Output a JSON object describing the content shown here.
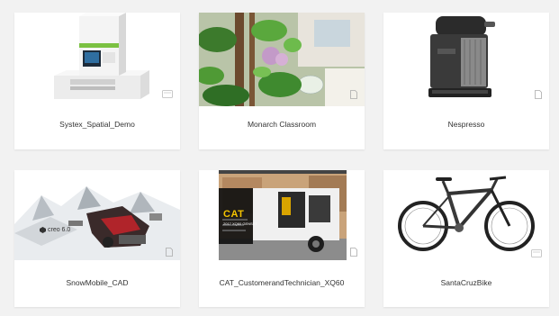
{
  "cards": [
    {
      "title": "Systex_Spatial_Demo",
      "thumbnail": "lab-analyzer-machine",
      "file_icon": "document-icon"
    },
    {
      "title": "Monarch Classroom",
      "thumbnail": "classroom-plants-scene",
      "file_icon": "document-icon"
    },
    {
      "title": "Nespresso",
      "thumbnail": "coffee-machine",
      "file_icon": "document-icon"
    },
    {
      "title": "SnowMobile_CAD",
      "thumbnail": "snowmobile-exploded-cad",
      "overlay_text": "creo 6.0",
      "file_icon": "document-icon"
    },
    {
      "title": "CAT_CustomerandTechnician_XQ60",
      "thumbnail": "cat-generator-trailer",
      "overlay_text": "CAT",
      "overlay_subtext": "2017 XQ60 GENSET",
      "file_icon": "document-icon"
    },
    {
      "title": "SantaCruzBike",
      "thumbnail": "mountain-bike",
      "file_icon": "document-icon"
    }
  ],
  "colors": {
    "page_background": "#f2f2f2",
    "card_background": "#ffffff",
    "caption_text": "#333333",
    "cat_yellow": "#f5c400"
  }
}
